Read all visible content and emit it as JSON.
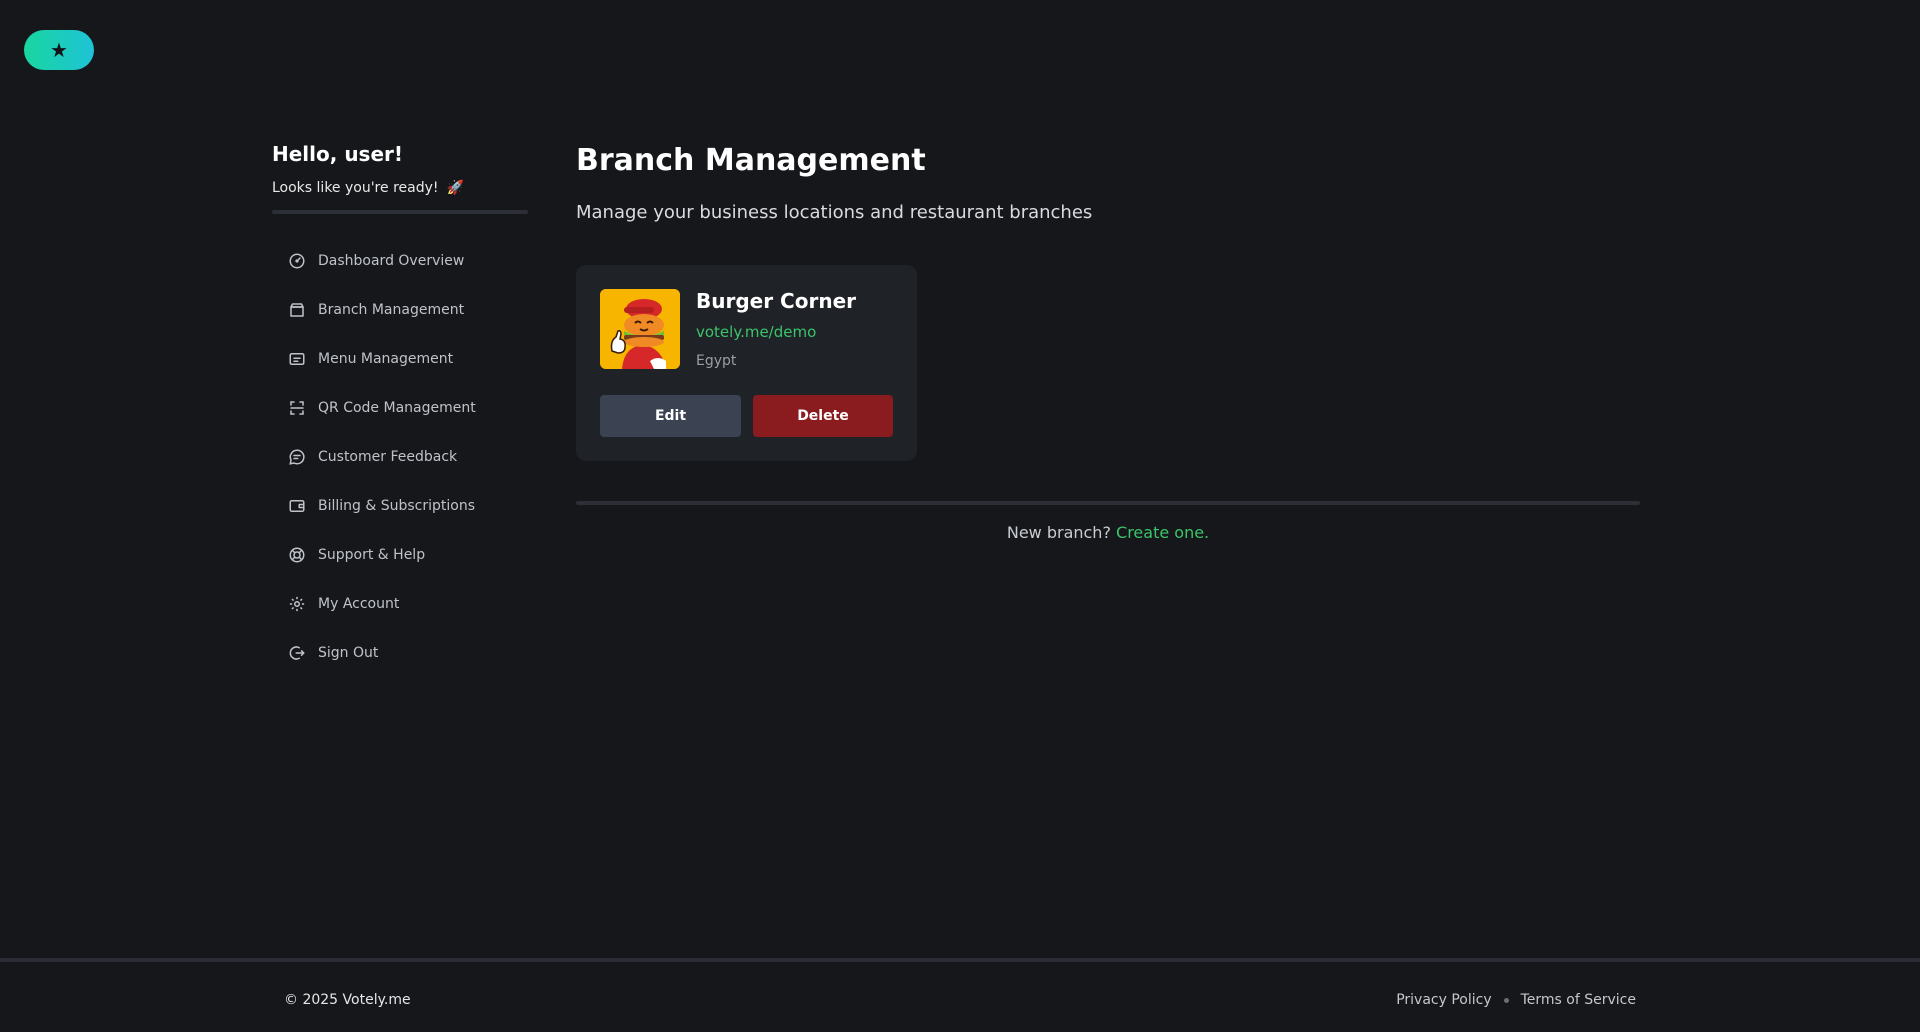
{
  "logo": {
    "icon": "star-icon",
    "glyph": "★"
  },
  "sidebar": {
    "greeting": "Hello, user!",
    "subtext": "Looks like you're ready!",
    "subtext_icon": "🚀",
    "items": [
      {
        "label": "Dashboard Overview",
        "icon": "gauge-icon"
      },
      {
        "label": "Branch Management",
        "icon": "store-icon"
      },
      {
        "label": "Menu Management",
        "icon": "menu-icon"
      },
      {
        "label": "QR Code Management",
        "icon": "qr-scan-icon"
      },
      {
        "label": "Customer Feedback",
        "icon": "chat-icon"
      },
      {
        "label": "Billing & Subscriptions",
        "icon": "wallet-icon"
      },
      {
        "label": "Support & Help",
        "icon": "lifebuoy-icon"
      },
      {
        "label": "My Account",
        "icon": "gear-icon"
      },
      {
        "label": "Sign Out",
        "icon": "sign-out-icon"
      }
    ]
  },
  "main": {
    "title": "Branch Management",
    "subtitle": "Manage your business locations and restaurant branches",
    "branch": {
      "name": "Burger Corner",
      "link": "votely.me/demo",
      "country": "Egypt",
      "edit_label": "Edit",
      "delete_label": "Delete"
    },
    "new_branch_prompt": "New branch?",
    "create_link": "Create one."
  },
  "footer": {
    "copyright": "© 2025 Votely.me",
    "privacy": "Privacy Policy",
    "terms": "Terms of Service"
  }
}
